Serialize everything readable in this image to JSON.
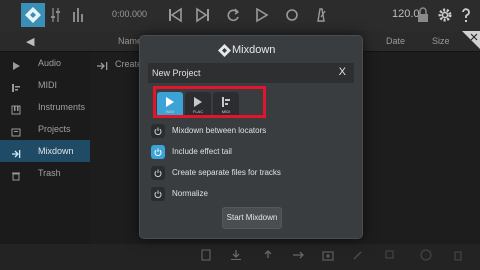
{
  "topbar": {
    "time": "0:00.000",
    "tempo": "120.0"
  },
  "header": {
    "col_name": "Name",
    "col_date": "Date",
    "col_size": "Size"
  },
  "sidebar": {
    "items": [
      {
        "label": "Audio",
        "icon": "play-icon"
      },
      {
        "label": "MIDI",
        "icon": "midi-icon"
      },
      {
        "label": "Instruments",
        "icon": "instrument-icon"
      },
      {
        "label": "Projects",
        "icon": "projects-icon"
      },
      {
        "label": "Mixdown",
        "icon": "mixdown-icon"
      },
      {
        "label": "Trash",
        "icon": "trash-icon"
      }
    ]
  },
  "main": {
    "create_label": "Create"
  },
  "dialog": {
    "title": "Mixdown",
    "project_name": "New Project",
    "close_label": "X",
    "formats": [
      {
        "label": "WAV",
        "selected": true
      },
      {
        "label": "FLAC",
        "selected": false
      },
      {
        "label": "MIDI",
        "selected": false
      }
    ],
    "options": [
      {
        "label": "Mixdown between locators",
        "on": false
      },
      {
        "label": "Include effect tail",
        "on": true
      },
      {
        "label": "Create separate files for tracks",
        "on": false
      },
      {
        "label": "Normalize",
        "on": false
      }
    ],
    "start_label": "Start Mixdown"
  },
  "colors": {
    "accent": "#3ba3d6",
    "highlight": "#e2152d",
    "dialog_bg": "#3a3d40"
  }
}
